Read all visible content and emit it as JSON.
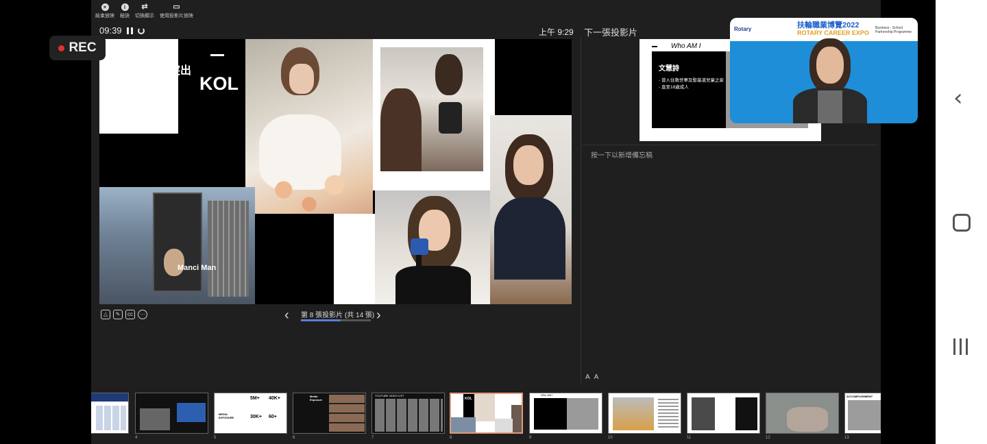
{
  "toolbar": {
    "items": [
      {
        "label": "結束放映",
        "icon": "close-icon"
      },
      {
        "label": "秘訣",
        "icon": "info-icon"
      },
      {
        "label": "切換顯示",
        "icon": "swap-icon"
      },
      {
        "label": "使用投影片放映",
        "icon": "slideshow-icon"
      }
    ]
  },
  "timer": "09:39",
  "clock": "上午 9:29",
  "next_label": "下一張投影片",
  "slide": {
    "kol": "KOL",
    "billboard": "最突出",
    "billboard_name": "Manci Man"
  },
  "pager": {
    "text": "第 8 張投影片 (共 14 張)",
    "current": 8,
    "total": 14,
    "progress": 0.57
  },
  "next_slide": {
    "title": "Who AM I",
    "name": "文慧詩",
    "bullets": [
      "- 曾入住救世軍及聖基道兒童之家",
      "- 直至18歲成人"
    ]
  },
  "notes_placeholder": "按一下以新增備忘稿",
  "font_controls": [
    "A",
    "A"
  ],
  "thumbnails": [
    {
      "num": "",
      "style": "blue"
    },
    {
      "num": "4",
      "style": "dark"
    },
    {
      "num": "5",
      "style": "stats",
      "label": "MEDIA EXPOSURE",
      "stats": [
        "5M+",
        "40K+",
        "30K+",
        "60+"
      ]
    },
    {
      "num": "6",
      "style": "media",
      "label": "Media Exposure"
    },
    {
      "num": "7",
      "style": "list",
      "label": "YOUTUBE VIDEO LIST"
    },
    {
      "num": "8",
      "style": "kol",
      "label": "KOL"
    },
    {
      "num": "9",
      "style": "who",
      "label": "Who AM I"
    },
    {
      "num": "10",
      "style": "photo"
    },
    {
      "num": "11",
      "style": "photo"
    },
    {
      "num": "12",
      "style": "room"
    },
    {
      "num": "13",
      "style": "accomp",
      "label": "ACCOMPLISHMENT"
    }
  ],
  "video": {
    "left_logo": "Rotary",
    "title_line1": "扶輪職業博覽2022",
    "title_line2": "ROTARY CAREER EXPO",
    "right_text": "Business - School Partnership Programme"
  },
  "rec_label": "REC",
  "colors": {
    "accent": "#5b7fd6",
    "active_thumb": "#e29a7a",
    "rec": "#e53030",
    "video_bg": "#1e8ed8"
  }
}
